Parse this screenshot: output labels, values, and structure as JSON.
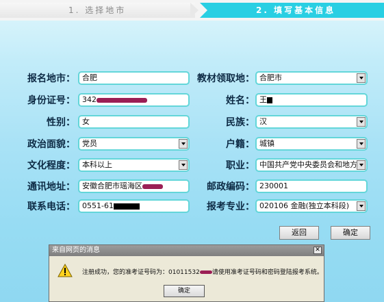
{
  "steps": {
    "step1": "1. 选择地市",
    "step2": "2. 填写基本信息"
  },
  "form": {
    "city_label": "报名地市",
    "city_value": "合肥",
    "pickup_label": "教材领取地",
    "pickup_value": "合肥市",
    "id_label": "身份证号",
    "id_value_prefix": "342",
    "name_label": "姓名",
    "name_value": "王",
    "gender_label": "性别",
    "gender_value": "女",
    "ethnic_label": "民族",
    "ethnic_value": "汉",
    "political_label": "政治面貌",
    "political_value": "党员",
    "hukou_label": "户籍",
    "hukou_value": "城镇",
    "education_label": "文化程度",
    "education_value": "本科以上",
    "occupation_label": "职业",
    "occupation_value": "中国共产党中央委员会和地方",
    "address_label": "通讯地址",
    "address_value": "安徽合肥市瑶海区",
    "postcode_label": "邮政编码",
    "postcode_value": "230001",
    "phone_label": "联系电话",
    "phone_value_prefix": "0551-61",
    "major_label": "报考专业",
    "major_value": "020106 金融(独立本科段)",
    "colon": "："
  },
  "buttons": {
    "back": "返回",
    "confirm": "确定"
  },
  "dialog": {
    "title": "来自网页的消息",
    "close": "✕",
    "message_prefix": "注册成功，您的准考证号码为：01011532",
    "message_suffix": "请使用准考证号码和密码登陆报考系统。",
    "ok": "确定"
  },
  "colors": {
    "accent": "#29cfe3",
    "field_border": "#63d6d9",
    "label": "#0d2a44"
  }
}
